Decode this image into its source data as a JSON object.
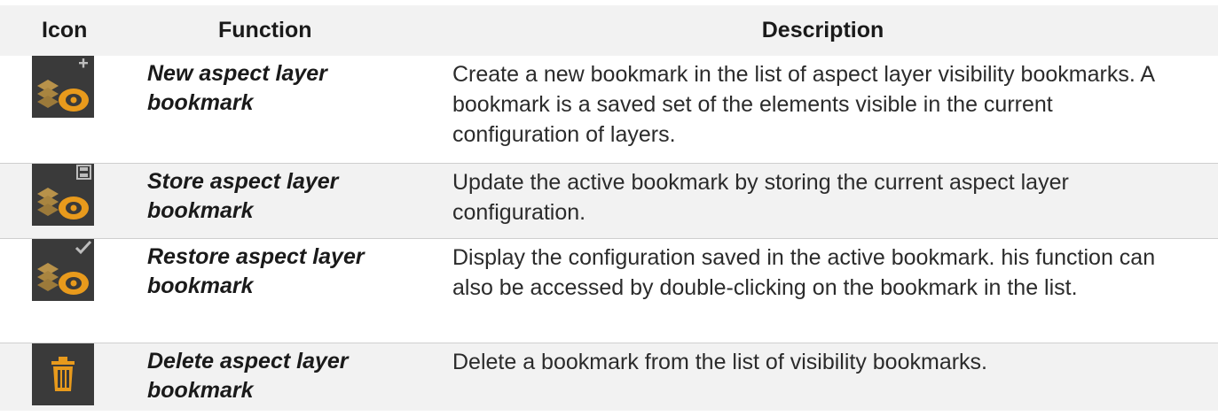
{
  "header": {
    "icon_label": "Icon",
    "function_label": "Function",
    "description_label": "Description"
  },
  "rows": [
    {
      "icon": "new-aspect-layer-bookmark-icon",
      "function": "New aspect layer bookmark",
      "description": "Create a new bookmark in the list of aspect layer visibility bookmarks. A bookmark is a saved set of the elements visible in the current configuration of layers."
    },
    {
      "icon": "store-aspect-layer-bookmark-icon",
      "function": "Store aspect layer bookmark",
      "description": "Update the active bookmark by storing the current aspect layer configuration."
    },
    {
      "icon": "restore-aspect-layer-bookmark-icon",
      "function": "Restore aspect layer bookmark",
      "description": "Display the configuration saved in the active bookmark. his function can also be accessed by double-clicking on the bookmark in the list."
    },
    {
      "icon": "trash-icon",
      "function": "Delete aspect layer bookmark",
      "description": "Delete a bookmark from the list of visibility bookmarks."
    }
  ],
  "colors": {
    "icon_background": "#3a3a3a",
    "icon_accent": "#e89a1c",
    "icon_layer": "#b8924a",
    "header_background": "#f2f2f2"
  }
}
